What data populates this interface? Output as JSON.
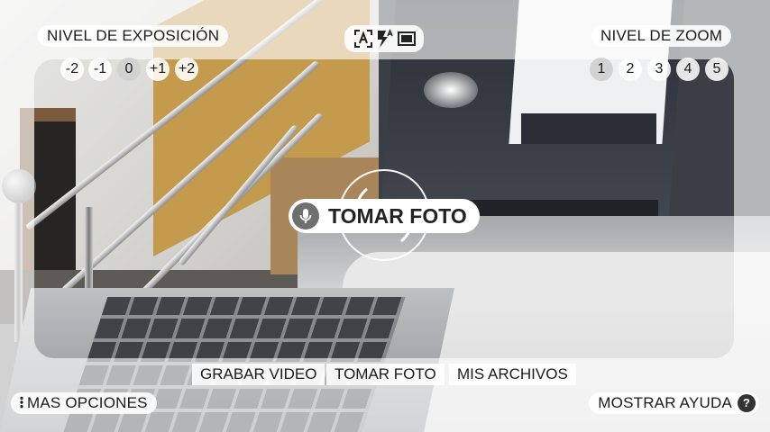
{
  "exposure": {
    "label": "NIVEL DE EXPOSICIÓN",
    "options": [
      "-2",
      "-1",
      "0",
      "+1",
      "+2"
    ],
    "selected": "0"
  },
  "zoom": {
    "label": "NIVEL DE ZOOM",
    "options": [
      "1",
      "2",
      "3",
      "4",
      "5"
    ],
    "selected": "1"
  },
  "modes": {
    "icons": [
      "auto-mode-icon",
      "flash-auto-icon",
      "aspect-ratio-icon"
    ]
  },
  "capture": {
    "voice_label": "TOMAR FOTO",
    "mic_icon": "microphone-icon"
  },
  "bottom_menu": {
    "record_video": "GRABAR VIDEO",
    "take_photo": "TOMAR FOTO",
    "my_files": "MIS ARCHIVOS"
  },
  "more_options": "MAS OPCIONES",
  "show_help": "MOSTRAR AYUDA",
  "help_icon_glyph": "?",
  "colors": {
    "pill_bg": "#ffffff",
    "text": "#1b1b1b",
    "mic_bg": "#6f6f6f"
  }
}
